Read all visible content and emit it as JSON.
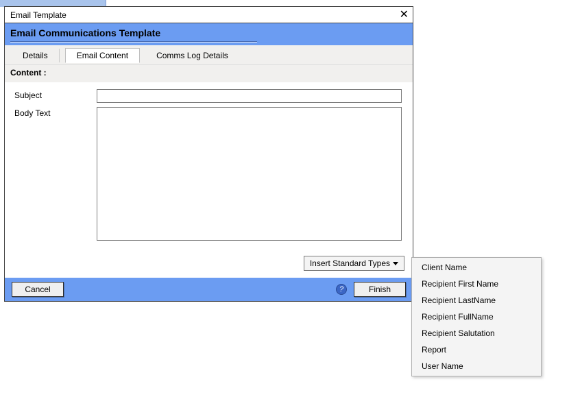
{
  "stub": "",
  "window": {
    "title": "Email Template",
    "banner_title": "Email Communications Template",
    "close_symbol": "✕"
  },
  "tabs": {
    "details": "Details",
    "email_content": "Email Content",
    "comms_log": "Comms Log Details"
  },
  "section": {
    "content_label": "Content :"
  },
  "form": {
    "subject_label": "Subject",
    "subject_value": "",
    "body_label": "Body Text",
    "body_value": ""
  },
  "insert_button": "Insert Standard Types",
  "footer": {
    "cancel": "Cancel",
    "finish": "Finish",
    "help": "?"
  },
  "menu": {
    "items": [
      "Client Name",
      "Recipient First Name",
      "Recipient LastName",
      "Recipient FullName",
      "Recipient Salutation",
      "Report",
      "User Name"
    ]
  }
}
